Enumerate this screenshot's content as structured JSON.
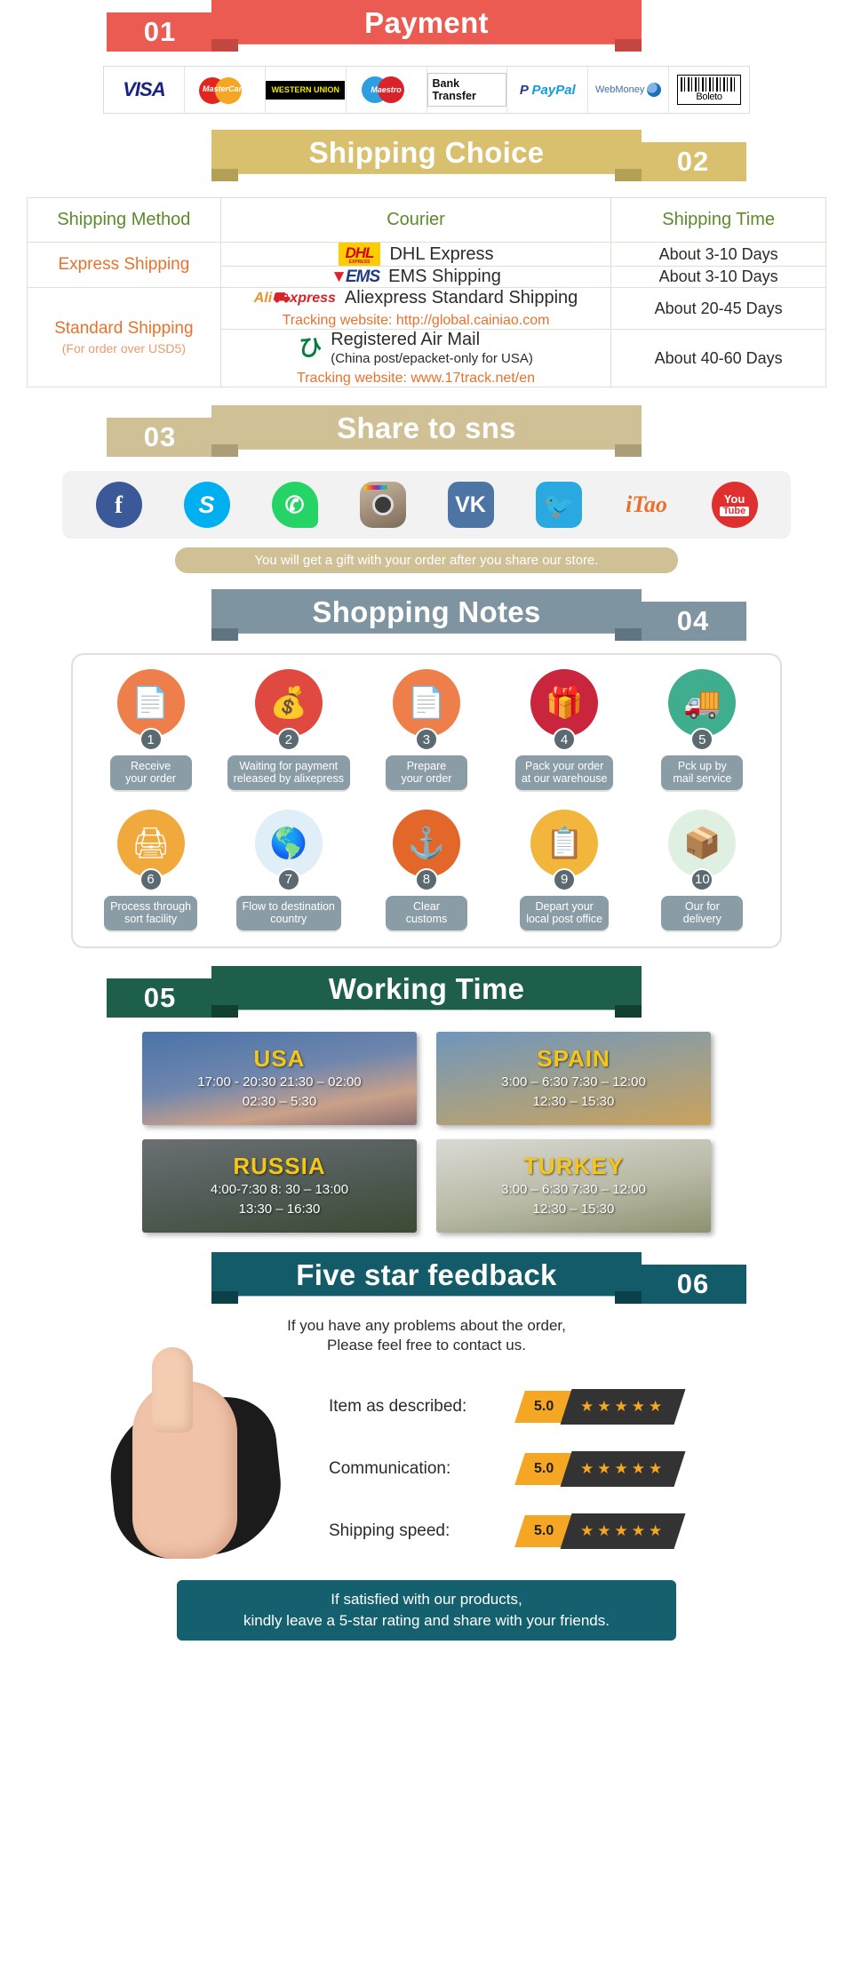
{
  "sections": {
    "payment": {
      "number": "01",
      "title": "Payment"
    },
    "shipping": {
      "number": "02",
      "title": "Shipping Choice"
    },
    "share": {
      "number": "03",
      "title": "Share to sns"
    },
    "notes": {
      "number": "04",
      "title": "Shopping Notes"
    },
    "working": {
      "number": "05",
      "title": "Working Time"
    },
    "feedback": {
      "number": "06",
      "title": "Five star feedback"
    }
  },
  "payment_methods": [
    {
      "name": "Visa",
      "label": "VISA"
    },
    {
      "name": "MasterCard",
      "label": "MasterCard"
    },
    {
      "name": "Western Union",
      "label": "WESTERN UNION"
    },
    {
      "name": "Maestro",
      "label": "Maestro"
    },
    {
      "name": "Bank Transfer",
      "label": "Bank Transfer"
    },
    {
      "name": "PayPal",
      "label": "PayPal"
    },
    {
      "name": "WebMoney",
      "label": "WebMoney"
    },
    {
      "name": "Boleto",
      "label": "Boleto"
    }
  ],
  "shipping_table": {
    "headers": [
      "Shipping Method",
      "Courier",
      "Shipping Time"
    ],
    "rows": [
      {
        "method": "Express Shipping",
        "method_note": "",
        "couriers": [
          {
            "logo": "DHL",
            "name": "DHL Express",
            "sub": "",
            "tracking": "",
            "time": "About 3-10 Days"
          },
          {
            "logo": "EMS",
            "name": "EMS Shipping",
            "sub": "",
            "tracking": "",
            "time": "About 3-10 Days"
          }
        ]
      },
      {
        "method": "Standard Shipping",
        "method_note": "(For order over USD5)",
        "couriers": [
          {
            "logo": "Aliexpress",
            "name": "Aliexpress Standard Shipping",
            "sub": "",
            "tracking": "Tracking website: http://global.cainiao.com",
            "time": "About 20-45 Days"
          },
          {
            "logo": "China Post",
            "name": "Registered Air Mail",
            "sub": "(China post/epacket-only for USA)",
            "tracking": "Tracking website: www.17track.net/en",
            "time": "About 40-60 Days"
          }
        ]
      }
    ]
  },
  "social": {
    "icons": [
      {
        "name": "facebook",
        "glyph": "f"
      },
      {
        "name": "skype",
        "glyph": "S"
      },
      {
        "name": "whatsapp",
        "glyph": "✆"
      },
      {
        "name": "instagram",
        "glyph": ""
      },
      {
        "name": "vk",
        "glyph": "VK"
      },
      {
        "name": "twitter",
        "glyph": "🐦"
      },
      {
        "name": "itao",
        "glyph": "iTao"
      },
      {
        "name": "youtube",
        "glyph": "You",
        "sub": "Tube"
      }
    ],
    "gift_text": "You will get a gift with your order after you share our store."
  },
  "shopping_notes": [
    {
      "num": "1",
      "caption": "Receive\nyour order",
      "icon": "document-hand-icon",
      "color": "c-orange"
    },
    {
      "num": "2",
      "caption": "Waiting for payment\nreleased by alixepress",
      "icon": "money-bag-icon",
      "color": "c-red"
    },
    {
      "num": "3",
      "caption": "Prepare\nyour order",
      "icon": "document-hand-icon",
      "color": "c-orange"
    },
    {
      "num": "4",
      "caption": "Pack your order\nat our warehouse",
      "icon": "gift-box-icon",
      "color": "c-crimson"
    },
    {
      "num": "5",
      "caption": "Pck up by\nmail service",
      "icon": "mail-truck-icon",
      "color": "c-green"
    },
    {
      "num": "6",
      "caption": "Process through\nsort facility",
      "icon": "scanner-icon",
      "color": "c-amber"
    },
    {
      "num": "7",
      "caption": "Flow to destination\ncountry",
      "icon": "globe-icon",
      "color": "c-sky"
    },
    {
      "num": "8",
      "caption": "Clear\ncustoms",
      "icon": "anchor-icon",
      "color": "c-dorange"
    },
    {
      "num": "9",
      "caption": "Depart your\nlocal post office",
      "icon": "clipboard-worker-icon",
      "color": "c-yellow"
    },
    {
      "num": "10",
      "caption": "Our for\ndelivery",
      "icon": "parcel-icon",
      "color": "c-mint"
    }
  ],
  "working_time": [
    {
      "country": "USA",
      "times": "17:00 - 20:30  21:30 – 02:00\n02:30 – 5:30",
      "bg": "bg-usa"
    },
    {
      "country": "SPAIN",
      "times": "3:00 – 6:30   7:30 – 12:00\n12:30 – 15:30",
      "bg": "bg-spain"
    },
    {
      "country": "RUSSIA",
      "times": "4:00-7:30   8: 30 – 13:00\n13:30 – 16:30",
      "bg": "bg-russia"
    },
    {
      "country": "TURKEY",
      "times": "3:00 – 6:30   7:30 – 12:00\n12:30 – 15:30",
      "bg": "bg-turkey"
    }
  ],
  "feedback": {
    "intro": "If you have any problems about the order,\nPlease feel free to contact us.",
    "ratings": [
      {
        "label": "Item as described:",
        "score": "5.0",
        "stars": "★★★★★"
      },
      {
        "label": "Communication:",
        "score": "5.0",
        "stars": "★★★★★"
      },
      {
        "label": "Shipping speed:",
        "score": "5.0",
        "stars": "★★★★★"
      }
    ],
    "footer": "If satisfied with our products,\nkindly leave a 5-star rating and share with your friends."
  },
  "colors": {
    "payment_red": "#eb5b52",
    "shipping_gold": "#d9c06e",
    "share_beige": "#cfc095",
    "notes_slate": "#7e94a0",
    "working_green": "#1d5f4b",
    "feedback_teal": "#145b69",
    "star_amber": "#f5a623"
  }
}
